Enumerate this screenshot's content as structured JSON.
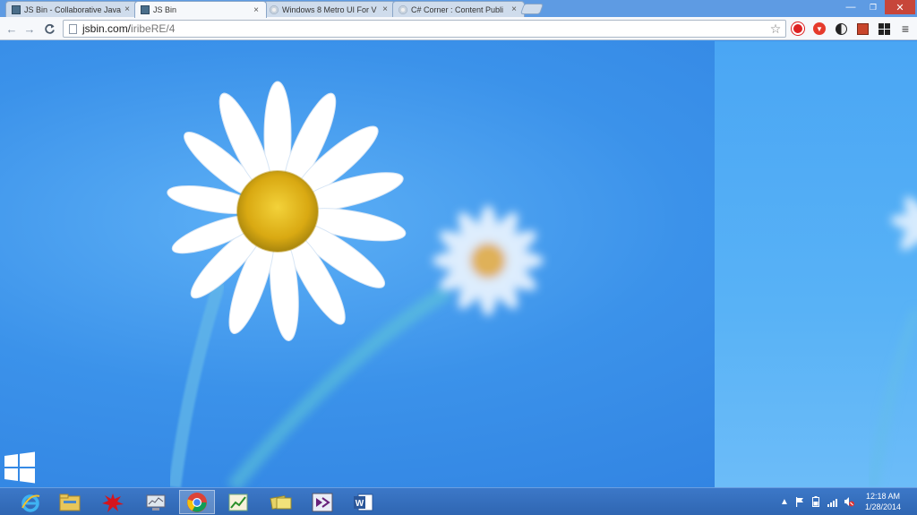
{
  "browser": {
    "tabs": [
      {
        "label": "JS Bin - Collaborative Java",
        "icon": "jsbin-favicon",
        "active": false
      },
      {
        "label": "JS Bin",
        "icon": "jsbin-favicon",
        "active": true
      },
      {
        "label": "Windows 8 Metro UI For V",
        "icon": "page-favicon",
        "active": false
      },
      {
        "label": "C# Corner : Content Publi",
        "icon": "page-favicon",
        "active": false
      }
    ],
    "close_glyph": "×",
    "window_controls": {
      "minimize": "—",
      "maximize": "❐",
      "close": "✕"
    },
    "nav": {
      "back": "←",
      "forward": "→",
      "reload": "C"
    },
    "url": {
      "host": "jsbin.com/",
      "path": "iribeRE/4"
    },
    "star_glyph": "☆",
    "menu_glyph": "≡"
  },
  "taskbar": {
    "apps": [
      "internet-explorer-icon",
      "file-explorer-icon",
      "paint-splat-icon",
      "monitor-app-icon",
      "chrome-icon",
      "chart-app-icon",
      "folders-icon",
      "visual-studio-icon",
      "word-icon"
    ],
    "active_app": "chrome-icon",
    "tray": {
      "show_hidden": "▲"
    },
    "clock": {
      "time": "12:18 AM",
      "date": "1/28/2014"
    }
  },
  "colors": {
    "accent": "#2f80e0",
    "taskbar": "#2f66b2",
    "close_button": "#c7463a"
  }
}
